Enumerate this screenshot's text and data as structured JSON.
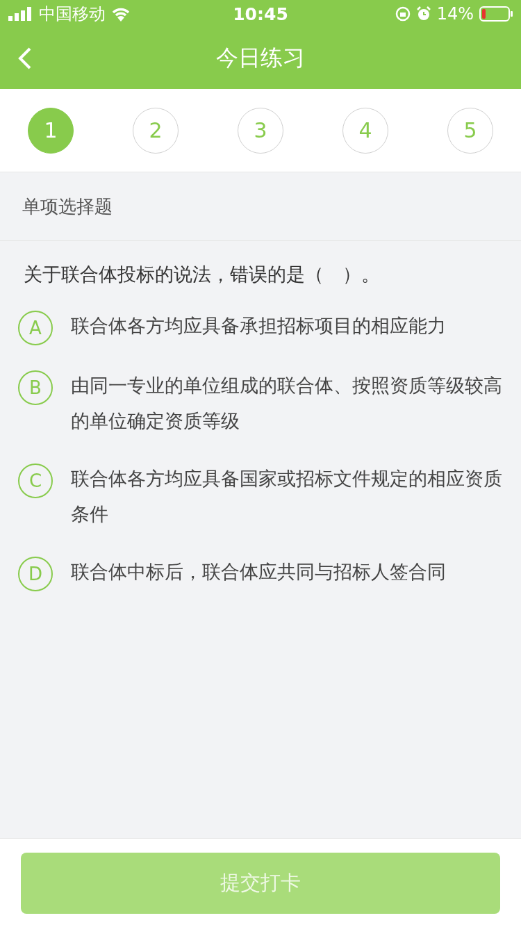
{
  "status_bar": {
    "carrier": "中国移动",
    "time": "10:45",
    "battery": "14%"
  },
  "nav_bar": {
    "title": "今日练习"
  },
  "steps": [
    {
      "label": "1",
      "selected": true
    },
    {
      "label": "2",
      "selected": false
    },
    {
      "label": "3",
      "selected": false
    },
    {
      "label": "4",
      "selected": false
    },
    {
      "label": "5",
      "selected": false
    }
  ],
  "question": {
    "type_label": "单项选择题",
    "text": "关于联合体投标的说法，错误的是（　）。",
    "options": [
      {
        "letter": "A",
        "text": "联合体各方均应具备承担招标项目的相应能力"
      },
      {
        "letter": "B",
        "text": "由同一专业的单位组成的联合体、按照资质等级较高的单位确定资质等级"
      },
      {
        "letter": "C",
        "text": "联合体各方均应具备国家或招标文件规定的相应资质条件"
      },
      {
        "letter": "D",
        "text": "联合体中标后，联合体应共同与招标人签合同"
      }
    ]
  },
  "submit_button": {
    "label": "提交打卡",
    "disabled": true
  }
}
